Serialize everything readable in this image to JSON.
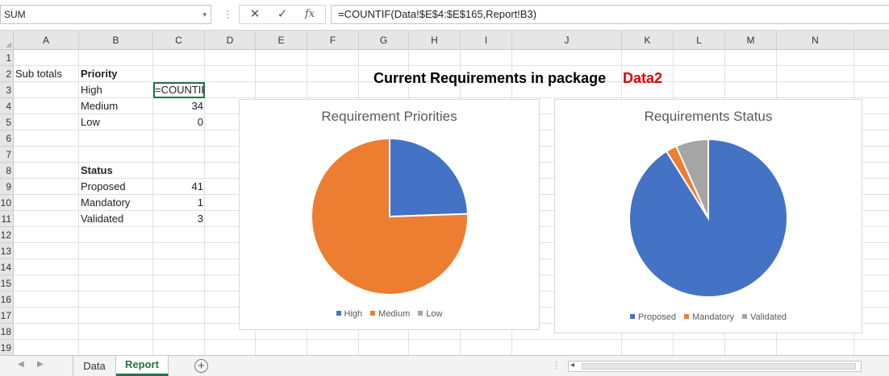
{
  "formula_bar": {
    "name_box": "SUM",
    "cancel_glyph": "✕",
    "enter_glyph": "✓",
    "fx_label": "fx",
    "formula": "=COUNTIF(Data!$E$4:$E$165,Report!B3)"
  },
  "columns": [
    "A",
    "B",
    "C",
    "D",
    "E",
    "F",
    "G",
    "H",
    "I",
    "J",
    "K",
    "L",
    "M",
    "N"
  ],
  "rows": [
    "1",
    "2",
    "3",
    "4",
    "5",
    "6",
    "7",
    "8",
    "9",
    "10",
    "11",
    "12",
    "13",
    "14",
    "15",
    "16",
    "17",
    "18",
    "19"
  ],
  "cells": {
    "a2": "Sub totals",
    "b2": "Priority",
    "b3": "High",
    "c3": "=COUNTIF",
    "b4": "Medium",
    "c4": "34",
    "b5": "Low",
    "c5": "0",
    "b8": "Status",
    "b9": "Proposed",
    "c9": "41",
    "b10": "Mandatory",
    "c10": "1",
    "b11": "Validated",
    "c11": "3"
  },
  "heading": {
    "main": "Current Requirements in package",
    "package": "Data2"
  },
  "chart_data": [
    {
      "type": "pie",
      "title": "Requirement Priorities",
      "categories": [
        "High",
        "Medium",
        "Low"
      ],
      "values": [
        11,
        34,
        0
      ],
      "colors": [
        "#4472c4",
        "#ed7d31",
        "#a5a5a5"
      ],
      "legend": "bottom"
    },
    {
      "type": "pie",
      "title": "Requirements Status",
      "categories": [
        "Proposed",
        "Mandatory",
        "Validated"
      ],
      "values": [
        41,
        1,
        3
      ],
      "colors": [
        "#4472c4",
        "#ed7d31",
        "#a5a5a5"
      ],
      "legend": "bottom"
    }
  ],
  "sheet_tabs": {
    "tab1": "Data",
    "tab2": "Report",
    "add_glyph": "+"
  },
  "icons": {
    "prev_sheet": "◀",
    "next_sheet": "▶",
    "name_box_dropdown": "▾",
    "scroll_left": "◂"
  },
  "colors": {
    "accent_green": "#217346",
    "title_red": "#e00000"
  }
}
